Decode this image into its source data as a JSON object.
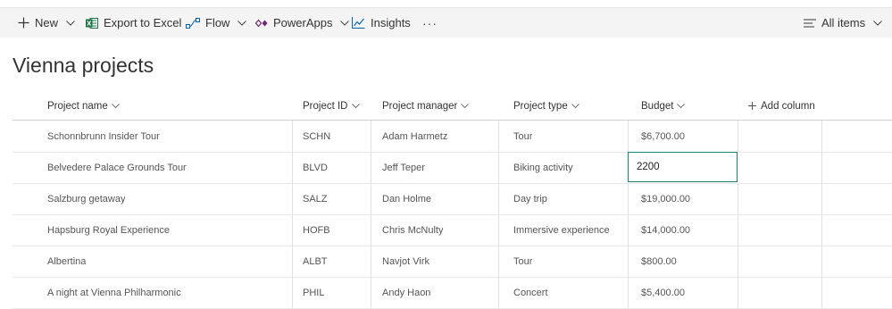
{
  "toolbar": {
    "new_label": "New",
    "export_label": "Export to Excel",
    "flow_label": "Flow",
    "powerapps_label": "PowerApps",
    "insights_label": "Insights",
    "more_label": "···",
    "view_label": "All items"
  },
  "list": {
    "title": "Vienna projects"
  },
  "columns": {
    "name": "Project name",
    "id": "Project ID",
    "manager": "Project manager",
    "type": "Project type",
    "budget": "Budget",
    "add": "Add column"
  },
  "rows": [
    {
      "name": "Schonnbrunn Insider Tour",
      "id": "SCHN",
      "manager": "Adam Harmetz",
      "type": "Tour",
      "budget": "$6,700.00"
    },
    {
      "name": "Belvedere Palace Grounds Tour",
      "id": "BLVD",
      "manager": "Jeff Teper",
      "type": "Biking activity",
      "budget": "2200"
    },
    {
      "name": "Salzburg getaway",
      "id": "SALZ",
      "manager": "Dan Holme",
      "type": "Day trip",
      "budget": "$19,000.00"
    },
    {
      "name": "Hapsburg Royal Experience",
      "id": "HOFB",
      "manager": "Chris McNulty",
      "type": "Immersive experience",
      "budget": "$14,000.00"
    },
    {
      "name": "Albertina",
      "id": "ALBT",
      "manager": "Navjot Virk",
      "type": "Tour",
      "budget": "$800.00"
    },
    {
      "name": "A night at Vienna Philharmonic",
      "id": "PHIL",
      "manager": "Andy Haon",
      "type": "Concert",
      "budget": "$5,400.00"
    }
  ],
  "colors": {
    "excel_green": "#1e7145",
    "powerapps_purple": "#742774",
    "edit_border": "#1b7f6f"
  }
}
